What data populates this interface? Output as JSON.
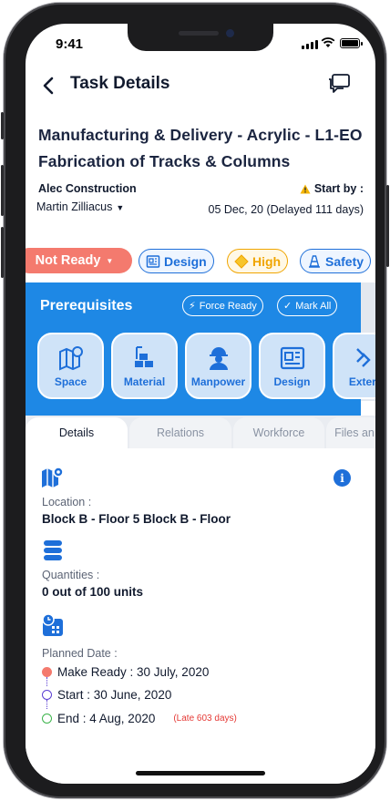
{
  "status_bar": {
    "time": "9:41"
  },
  "header": {
    "title": "Task Details"
  },
  "task": {
    "title": "Manufacturing & Delivery - Acrylic - L1-EO Fabrication of Tracks & Columns",
    "company": "Alec Construction",
    "assignee": "Martin Zilliacus",
    "start_label": "Start by :",
    "start_date": "05 Dec, 20 (Delayed 111 days)"
  },
  "tags": {
    "status": "Not Ready",
    "design": "Design",
    "priority": "High",
    "safety": "Safety"
  },
  "prerequisites": {
    "title": "Prerequisites",
    "force_ready": "Force Ready",
    "mark_all": "Mark All",
    "tiles": [
      "Space",
      "Material",
      "Manpower",
      "Design",
      "Extern"
    ]
  },
  "tabs": [
    "Details",
    "Relations",
    "Workforce",
    "Files an"
  ],
  "details": {
    "location_label": "Location :",
    "location_value": "Block B - Floor 5 Block B - Floor",
    "quantities_label": "Quantities :",
    "quantities_value": "0 out of 100 units",
    "planned_label": "Planned Date :",
    "make_ready": "Make Ready : 30 July, 2020",
    "start": "Start : 30 June, 2020",
    "end": "End : 4 Aug, 2020",
    "late": "(Late 603 days)"
  },
  "colors": {
    "accent_blue": "#1e88e5",
    "not_ready": "#f47a6e",
    "high": "#f0a500",
    "late_red": "#e53935"
  }
}
